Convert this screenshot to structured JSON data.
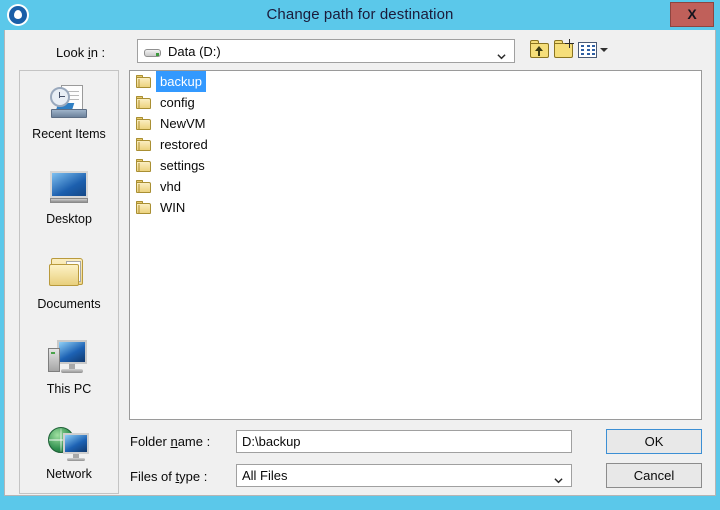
{
  "window": {
    "title": "Change path for destination",
    "app_icon": "target-location-icon",
    "close_label": "X",
    "titlebar_color": "#5bc8ea",
    "close_button_color": "#c0605a",
    "body_color": "#f0f0f0"
  },
  "lookin": {
    "label_before": "Look ",
    "label_mnemonic": "i",
    "label_after": "n :",
    "value": "Data (D:)",
    "icon": "drive-icon"
  },
  "toolbar": {
    "buttons": [
      {
        "name": "up-one-level-button",
        "icon": "folder-up-arrow-icon"
      },
      {
        "name": "create-new-folder-button",
        "icon": "new-folder-sparkle-icon"
      },
      {
        "name": "views-dropdown-button",
        "icon": "views-grid-icon"
      }
    ]
  },
  "places": {
    "items": [
      {
        "label": "Recent Items",
        "icon": "recent-items-icon"
      },
      {
        "label": "Desktop",
        "icon": "desktop-monitor-icon"
      },
      {
        "label": "Documents",
        "icon": "documents-folder-icon"
      },
      {
        "label": "This PC",
        "icon": "this-pc-computer-icon"
      },
      {
        "label": "Network",
        "icon": "network-globe-icon"
      }
    ]
  },
  "filelist": {
    "selection_color": "#3399ff",
    "items": [
      {
        "name": "backup",
        "icon": "folder-icon",
        "selected": true
      },
      {
        "name": "config",
        "icon": "folder-icon",
        "selected": false
      },
      {
        "name": "NewVM",
        "icon": "folder-icon",
        "selected": false
      },
      {
        "name": "restored",
        "icon": "folder-icon",
        "selected": false
      },
      {
        "name": "settings",
        "icon": "folder-icon",
        "selected": false
      },
      {
        "name": "vhd",
        "icon": "folder-icon",
        "selected": false
      },
      {
        "name": "WIN",
        "icon": "folder-icon",
        "selected": false
      }
    ]
  },
  "foldername": {
    "label_before": "Folder ",
    "label_mnemonic": "n",
    "label_after": "ame :",
    "value": "D:\\backup",
    "placeholder": ""
  },
  "filetype": {
    "label_before": "Files of ",
    "label_mnemonic": "t",
    "label_after": "ype :",
    "value": "All Files"
  },
  "actions": {
    "ok_label": "OK",
    "cancel_label": "Cancel"
  }
}
